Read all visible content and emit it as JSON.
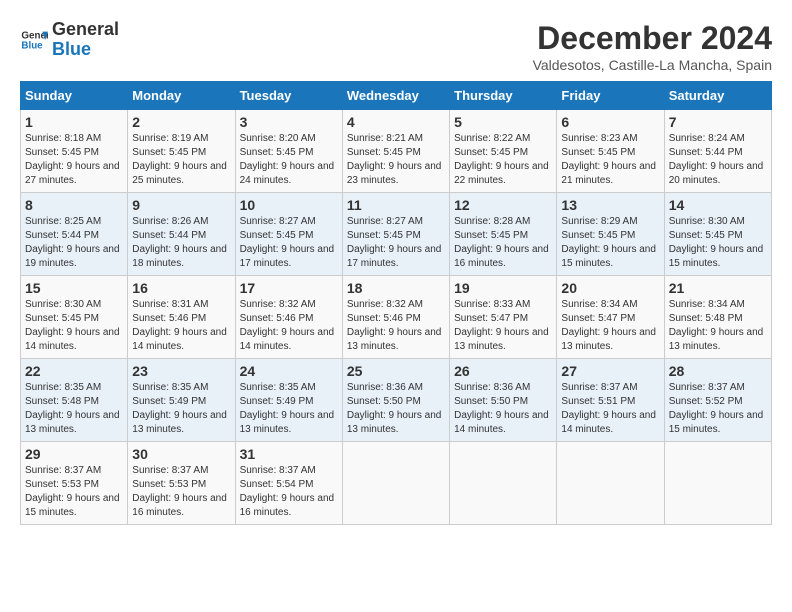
{
  "header": {
    "logo_line1": "General",
    "logo_line2": "Blue",
    "month_year": "December 2024",
    "location": "Valdesotos, Castille-La Mancha, Spain"
  },
  "days_of_week": [
    "Sunday",
    "Monday",
    "Tuesday",
    "Wednesday",
    "Thursday",
    "Friday",
    "Saturday"
  ],
  "weeks": [
    [
      {
        "day": "1",
        "info": "Sunrise: 8:18 AM\nSunset: 5:45 PM\nDaylight: 9 hours and 27 minutes."
      },
      {
        "day": "2",
        "info": "Sunrise: 8:19 AM\nSunset: 5:45 PM\nDaylight: 9 hours and 25 minutes."
      },
      {
        "day": "3",
        "info": "Sunrise: 8:20 AM\nSunset: 5:45 PM\nDaylight: 9 hours and 24 minutes."
      },
      {
        "day": "4",
        "info": "Sunrise: 8:21 AM\nSunset: 5:45 PM\nDaylight: 9 hours and 23 minutes."
      },
      {
        "day": "5",
        "info": "Sunrise: 8:22 AM\nSunset: 5:45 PM\nDaylight: 9 hours and 22 minutes."
      },
      {
        "day": "6",
        "info": "Sunrise: 8:23 AM\nSunset: 5:45 PM\nDaylight: 9 hours and 21 minutes."
      },
      {
        "day": "7",
        "info": "Sunrise: 8:24 AM\nSunset: 5:44 PM\nDaylight: 9 hours and 20 minutes."
      }
    ],
    [
      {
        "day": "8",
        "info": "Sunrise: 8:25 AM\nSunset: 5:44 PM\nDaylight: 9 hours and 19 minutes."
      },
      {
        "day": "9",
        "info": "Sunrise: 8:26 AM\nSunset: 5:44 PM\nDaylight: 9 hours and 18 minutes."
      },
      {
        "day": "10",
        "info": "Sunrise: 8:27 AM\nSunset: 5:45 PM\nDaylight: 9 hours and 17 minutes."
      },
      {
        "day": "11",
        "info": "Sunrise: 8:27 AM\nSunset: 5:45 PM\nDaylight: 9 hours and 17 minutes."
      },
      {
        "day": "12",
        "info": "Sunrise: 8:28 AM\nSunset: 5:45 PM\nDaylight: 9 hours and 16 minutes."
      },
      {
        "day": "13",
        "info": "Sunrise: 8:29 AM\nSunset: 5:45 PM\nDaylight: 9 hours and 15 minutes."
      },
      {
        "day": "14",
        "info": "Sunrise: 8:30 AM\nSunset: 5:45 PM\nDaylight: 9 hours and 15 minutes."
      }
    ],
    [
      {
        "day": "15",
        "info": "Sunrise: 8:30 AM\nSunset: 5:45 PM\nDaylight: 9 hours and 14 minutes."
      },
      {
        "day": "16",
        "info": "Sunrise: 8:31 AM\nSunset: 5:46 PM\nDaylight: 9 hours and 14 minutes."
      },
      {
        "day": "17",
        "info": "Sunrise: 8:32 AM\nSunset: 5:46 PM\nDaylight: 9 hours and 14 minutes."
      },
      {
        "day": "18",
        "info": "Sunrise: 8:32 AM\nSunset: 5:46 PM\nDaylight: 9 hours and 13 minutes."
      },
      {
        "day": "19",
        "info": "Sunrise: 8:33 AM\nSunset: 5:47 PM\nDaylight: 9 hours and 13 minutes."
      },
      {
        "day": "20",
        "info": "Sunrise: 8:34 AM\nSunset: 5:47 PM\nDaylight: 9 hours and 13 minutes."
      },
      {
        "day": "21",
        "info": "Sunrise: 8:34 AM\nSunset: 5:48 PM\nDaylight: 9 hours and 13 minutes."
      }
    ],
    [
      {
        "day": "22",
        "info": "Sunrise: 8:35 AM\nSunset: 5:48 PM\nDaylight: 9 hours and 13 minutes."
      },
      {
        "day": "23",
        "info": "Sunrise: 8:35 AM\nSunset: 5:49 PM\nDaylight: 9 hours and 13 minutes."
      },
      {
        "day": "24",
        "info": "Sunrise: 8:35 AM\nSunset: 5:49 PM\nDaylight: 9 hours and 13 minutes."
      },
      {
        "day": "25",
        "info": "Sunrise: 8:36 AM\nSunset: 5:50 PM\nDaylight: 9 hours and 13 minutes."
      },
      {
        "day": "26",
        "info": "Sunrise: 8:36 AM\nSunset: 5:50 PM\nDaylight: 9 hours and 14 minutes."
      },
      {
        "day": "27",
        "info": "Sunrise: 8:37 AM\nSunset: 5:51 PM\nDaylight: 9 hours and 14 minutes."
      },
      {
        "day": "28",
        "info": "Sunrise: 8:37 AM\nSunset: 5:52 PM\nDaylight: 9 hours and 15 minutes."
      }
    ],
    [
      {
        "day": "29",
        "info": "Sunrise: 8:37 AM\nSunset: 5:53 PM\nDaylight: 9 hours and 15 minutes."
      },
      {
        "day": "30",
        "info": "Sunrise: 8:37 AM\nSunset: 5:53 PM\nDaylight: 9 hours and 16 minutes."
      },
      {
        "day": "31",
        "info": "Sunrise: 8:37 AM\nSunset: 5:54 PM\nDaylight: 9 hours and 16 minutes."
      },
      {
        "day": "",
        "info": ""
      },
      {
        "day": "",
        "info": ""
      },
      {
        "day": "",
        "info": ""
      },
      {
        "day": "",
        "info": ""
      }
    ]
  ]
}
